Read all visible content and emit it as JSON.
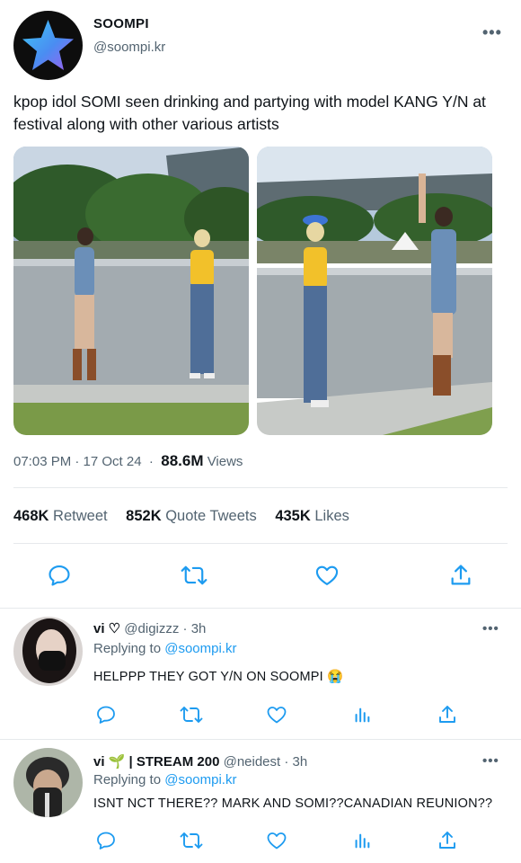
{
  "tweet": {
    "author_name": "SOOMPI",
    "author_handle": "@soompi.kr",
    "text": "kpop idol SOMI seen drinking and partying with model KANG Y/N at festival along with other various artists",
    "time": "07:03 PM · 17 Oct 24",
    "views_count": "88.6M",
    "views_label": "Views",
    "retweets_count": "468K",
    "retweets_label": "Retweet",
    "quotes_count": "852K",
    "quotes_label": "Quote Tweets",
    "likes_count": "435K",
    "likes_label": "Likes"
  },
  "replies": [
    {
      "name": "vi ♡",
      "handle": "@digizzz",
      "time": "3h",
      "replying_label": "Replying to",
      "replying_handle": "@soompi.kr",
      "text": "HELPPP THEY GOT Y/N ON SOOMPI 😭"
    },
    {
      "name": "vi 🌱 | STREAM 200",
      "handle": "@neidest",
      "time": "3h",
      "replying_label": "Replying to",
      "replying_handle": "@soompi.kr",
      "text": "ISNT NCT THERE?? MARK AND SOMI??CANADIAN REUNION??"
    }
  ],
  "colors": {
    "accent": "#1d9bf0",
    "secondary_text": "#536471",
    "icon": "#1d9bf0",
    "reply_icon": "#5b7083"
  },
  "icons": [
    "star-logo-icon",
    "more-icon",
    "reply-icon",
    "retweet-icon",
    "like-icon",
    "share-icon",
    "analytics-icon"
  ]
}
